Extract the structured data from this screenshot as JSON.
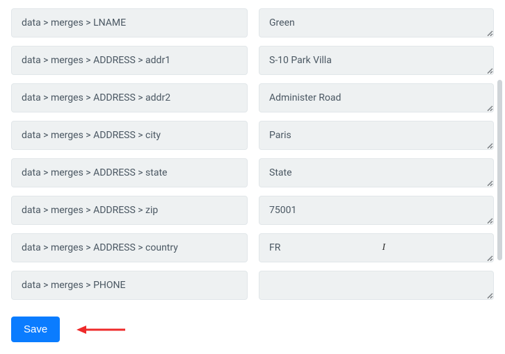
{
  "rows": [
    {
      "label": "data > merges > LNAME",
      "value": "Green"
    },
    {
      "label": "data > merges > ADDRESS > addr1",
      "value": "S-10 Park Villa"
    },
    {
      "label": "data > merges > ADDRESS > addr2",
      "value": "Administer Road"
    },
    {
      "label": "data > merges > ADDRESS > city",
      "value": "Paris"
    },
    {
      "label": "data > merges > ADDRESS > state",
      "value": "State"
    },
    {
      "label": "data > merges > ADDRESS > zip",
      "value": "75001"
    },
    {
      "label": "data > merges > ADDRESS > country",
      "value": "FR",
      "cursor": true
    },
    {
      "label": "data > merges > PHONE",
      "value": ""
    }
  ],
  "buttons": {
    "save_label": "Save"
  }
}
